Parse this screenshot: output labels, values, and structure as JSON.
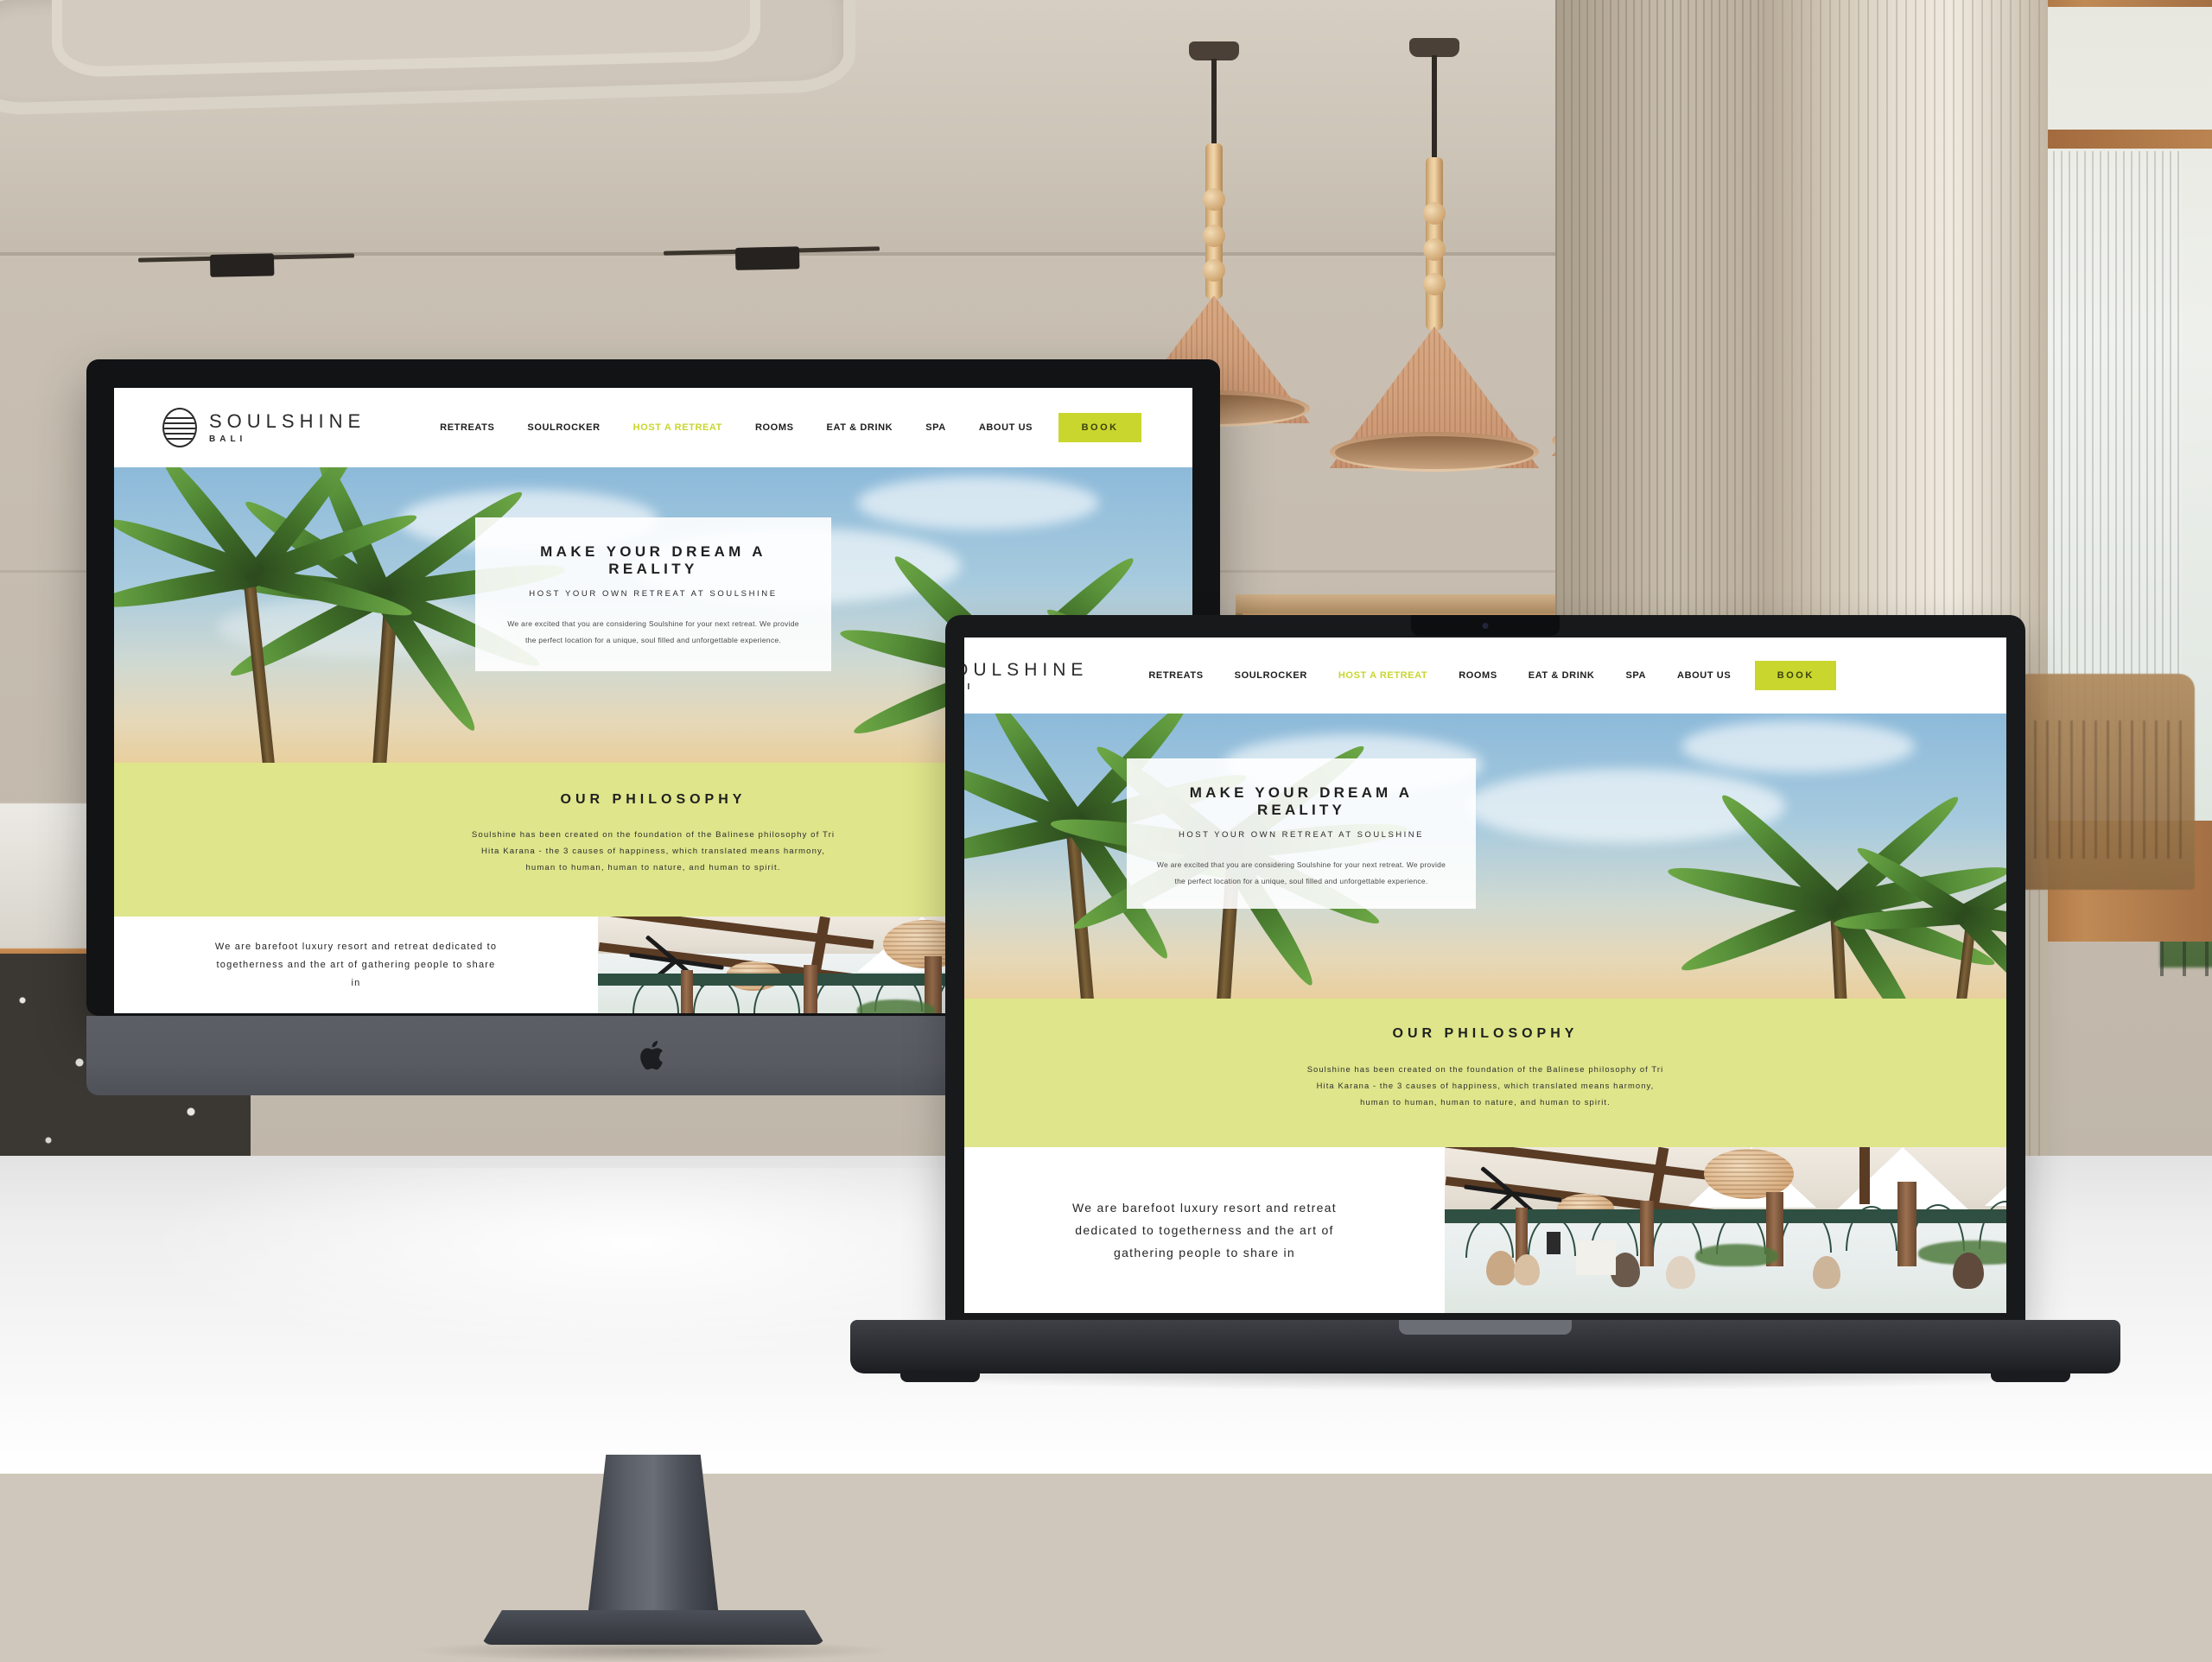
{
  "site": {
    "brand": {
      "name": "SOULSHINE",
      "sub": "BALI",
      "logo_icon": "striped-circle-sun-logo"
    },
    "nav_items": [
      {
        "label": "RETREATS",
        "active": false
      },
      {
        "label": "SOULROCKER",
        "active": false
      },
      {
        "label": "HOST A RETREAT",
        "active": true
      },
      {
        "label": "ROOMS",
        "active": false
      },
      {
        "label": "EAT & DRINK",
        "active": false
      },
      {
        "label": "SPA",
        "active": false
      },
      {
        "label": "ABOUT US",
        "active": false
      }
    ],
    "book_button": "BOOK",
    "hero": {
      "title": "MAKE YOUR DREAM A REALITY",
      "subtitle": "HOST YOUR OWN RETREAT AT SOULSHINE",
      "body": "We are excited that you are considering Soulshine for your next retreat. We provide the perfect location for a unique, soul filled and unforgettable experience."
    },
    "philosophy": {
      "heading": "OUR PHILOSOPHY",
      "body": "Soulshine has been created on the foundation of the Balinese philosophy of Tri Hita Karana - the 3 causes of happiness, which translated means harmony, human to human, human to nature, and human to spirit."
    },
    "lower": {
      "body": "We are barefoot luxury resort and retreat dedicated to togetherness and the art of gathering people to share in"
    },
    "colors": {
      "accent_button": "#c9d62e",
      "accent_band": "#dee58a",
      "nav_text": "#1d1d1d",
      "active_nav": "#c9d62e"
    }
  },
  "devices": {
    "desktop": {
      "name": "iMac Pro",
      "finish": "Space Gray",
      "logo_icon": "apple-logo"
    },
    "laptop": {
      "name": "MacBook Pro",
      "finish": "Space Black",
      "logo_icon": "apple-logo"
    }
  },
  "scene": {
    "description": "Interior room with rattan pendant lamps, sheer curtains and a wood framed window",
    "pendant_count": 3,
    "sconce_count": 2
  }
}
